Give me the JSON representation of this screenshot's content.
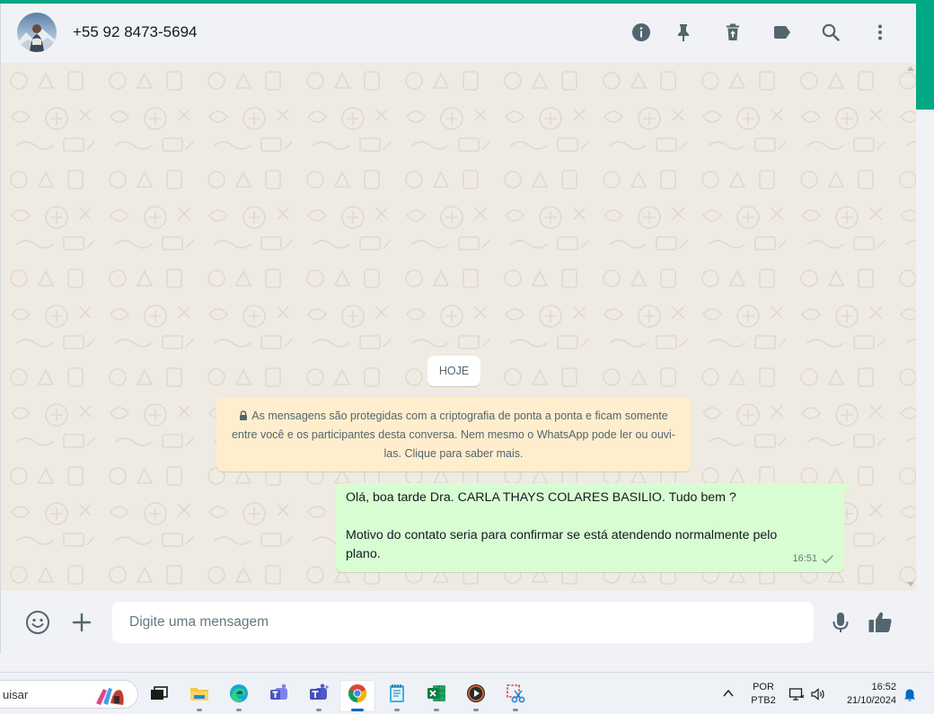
{
  "header": {
    "contact_name": "+55 92 8473-5694"
  },
  "chat": {
    "date_chip": "HOJE",
    "encryption_notice": "As mensagens são protegidas com a criptografia de ponta a ponta e ficam somente entre você e os participantes desta conversa. Nem mesmo o WhatsApp pode ler ou ouvi-las. Clique para saber mais.",
    "messages": [
      {
        "line1": "Olá, boa tarde Dra. CARLA THAYS COLARES BASILIO. Tudo bem ?",
        "line2": "Motivo do contato seria para confirmar se está atendendo normalmente pelo",
        "line3": "plano.",
        "time": "16:51",
        "status": "sent"
      }
    ]
  },
  "footer": {
    "input_placeholder": "Digite uma mensagem"
  },
  "taskbar": {
    "search_text": "uisar",
    "lang_line1": "POR",
    "lang_line2": "PTB2",
    "time": "16:52",
    "date": "21/10/2024"
  },
  "colors": {
    "accent": "#00a884",
    "outgoing_bubble": "#d9fdd3",
    "notice": "#ffeecd",
    "chat_bg": "#efeae2",
    "panel": "#f0f2f5"
  }
}
